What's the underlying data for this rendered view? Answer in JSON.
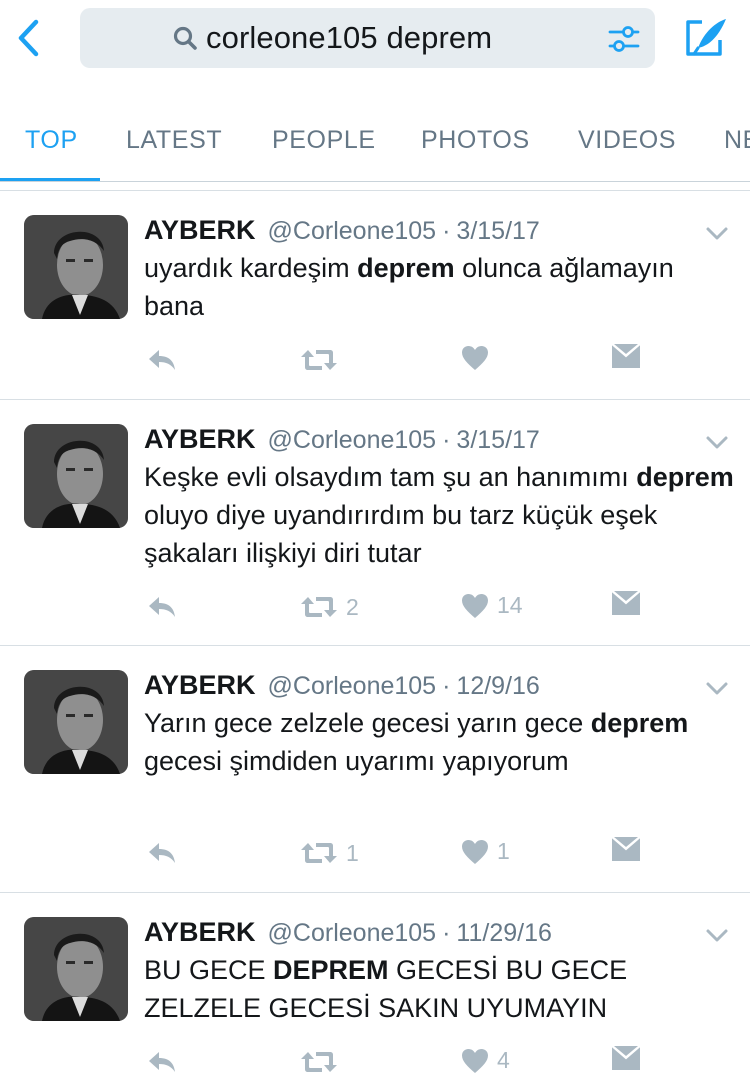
{
  "search": {
    "query": "corleone105 deprem"
  },
  "tabs": [
    {
      "label": "TOP",
      "active": true
    },
    {
      "label": "LATEST",
      "active": false
    },
    {
      "label": "PEOPLE",
      "active": false
    },
    {
      "label": "PHOTOS",
      "active": false
    },
    {
      "label": "VIDEOS",
      "active": false
    },
    {
      "label": "NE",
      "active": false
    }
  ],
  "icons": {
    "back": "chevron-left-icon",
    "search": "search-icon",
    "filter": "filter-sliders-icon",
    "compose": "compose-tweet-icon",
    "reply": "reply-icon",
    "retweet": "retweet-icon",
    "like": "heart-icon",
    "dm": "direct-message-icon",
    "more": "chevron-down-icon"
  },
  "colors": {
    "accent": "#1da1f2",
    "secondary_text": "#657786",
    "icon_gray": "#aab8c2",
    "search_bg": "#e6ecf0"
  },
  "tweets": [
    {
      "name": "AYBERK",
      "handle": "@Corleone105",
      "separator": "·",
      "date": "3/15/17",
      "text_parts": [
        {
          "text": "uyardık kardeşim ",
          "bold": false
        },
        {
          "text": "deprem",
          "bold": true
        },
        {
          "text": " olunca ağlamayın bana",
          "bold": false
        }
      ],
      "retweets": "",
      "likes": ""
    },
    {
      "name": "AYBERK",
      "handle": "@Corleone105",
      "separator": "·",
      "date": "3/15/17",
      "text_parts": [
        {
          "text": "Keşke evli olsaydım tam şu an hanımımı ",
          "bold": false
        },
        {
          "text": "deprem",
          "bold": true
        },
        {
          "text": " oluyo diye uyandırırdım bu tarz küçük eşek şakaları ilişkiyi diri tutar",
          "bold": false
        }
      ],
      "retweets": "2",
      "likes": "14"
    },
    {
      "name": "AYBERK",
      "handle": "@Corleone105",
      "separator": "·",
      "date": "12/9/16",
      "text_parts": [
        {
          "text": "Yarın gece zelzele gecesi yarın gece ",
          "bold": false
        },
        {
          "text": "deprem",
          "bold": true
        },
        {
          "text": " gecesi şimdiden uyarımı yapıyorum",
          "bold": false
        }
      ],
      "retweets": "1",
      "likes": "1"
    },
    {
      "name": "AYBERK",
      "handle": "@Corleone105",
      "separator": "·",
      "date": "11/29/16",
      "text_parts": [
        {
          "text": "BU GECE ",
          "bold": false
        },
        {
          "text": "DEPREM",
          "bold": true
        },
        {
          "text": " GECESİ BU GECE ZELZELE GECESİ SAKIN UYUMAYIN",
          "bold": false
        }
      ],
      "retweets": "",
      "likes": "4"
    }
  ]
}
